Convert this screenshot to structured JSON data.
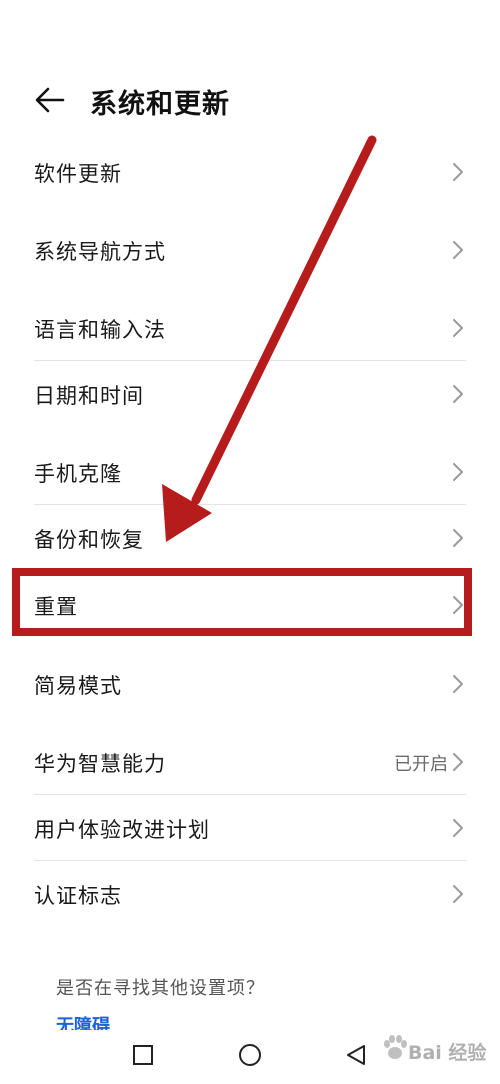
{
  "header": {
    "title": "系统和更新",
    "back_icon": "arrow-left-icon"
  },
  "settings": {
    "items": [
      {
        "label": "软件更新",
        "value": ""
      },
      {
        "label": "系统导航方式",
        "value": ""
      },
      {
        "label": "语言和输入法",
        "value": ""
      },
      {
        "label": "日期和时间",
        "value": ""
      },
      {
        "label": "手机克隆",
        "value": ""
      },
      {
        "label": "备份和恢复",
        "value": ""
      },
      {
        "label": "重置",
        "value": ""
      },
      {
        "label": "简易模式",
        "value": ""
      },
      {
        "label": "华为智慧能力",
        "value": "已开启"
      },
      {
        "label": "用户体验改进计划",
        "value": ""
      },
      {
        "label": "认证标志",
        "value": ""
      }
    ]
  },
  "footer": {
    "question": "是否在寻找其他设置项？",
    "link": "无障碍"
  },
  "navbar": {
    "icons": [
      "square-recents-icon",
      "circle-home-icon",
      "triangle-back-icon"
    ]
  },
  "watermark": {
    "text": "Bai 经验"
  },
  "annotation": {
    "arrow_color": "#b71c1c",
    "box_color": "#b71c1c",
    "highlighted_item": "重置"
  }
}
